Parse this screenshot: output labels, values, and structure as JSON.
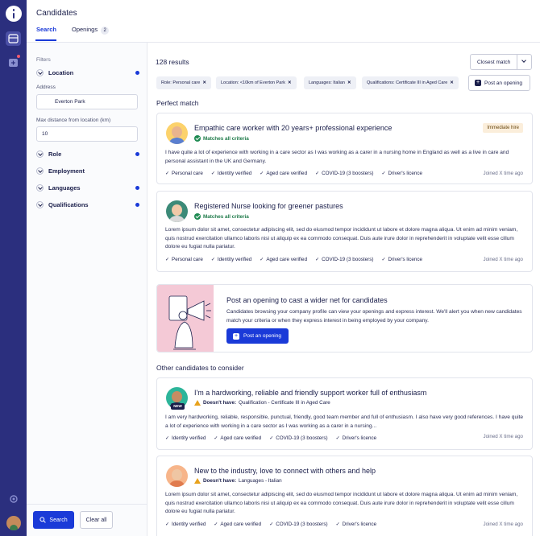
{
  "header": {
    "title": "Candidates",
    "tabs": [
      {
        "label": "Search"
      },
      {
        "label": "Openings",
        "count": "2"
      }
    ]
  },
  "filters": {
    "title": "Filters",
    "location": {
      "label": "Location",
      "address_label": "Address",
      "address_value": "Everton Park",
      "distance_label": "Max distance from location (km)",
      "distance_value": "10"
    },
    "groups": [
      {
        "label": "Role",
        "active": true
      },
      {
        "label": "Employment",
        "active": false
      },
      {
        "label": "Languages",
        "active": true
      },
      {
        "label": "Qualifications",
        "active": true
      }
    ],
    "search_button": "Search",
    "clear_button": "Clear all"
  },
  "results": {
    "count": "128 results",
    "sort_label": "Closest match",
    "chips": [
      "Role: Personal care",
      "Location: <10km of Everton Park",
      "Languages: Italian",
      "Qualifications: Certificate III in Aged Care"
    ],
    "post_opening": "Post an opening"
  },
  "perfect_match": {
    "title": "Perfect match",
    "cards": [
      {
        "title": "Empathic care worker with 20 years+ professional experience",
        "match": "Matches all criteria",
        "badge": "Immediate hire",
        "body": "I have quite a lot of experience with working in a care sector as I was working as a carer in a nursing home in England as well as a live in care and personal assistant in the UK and Germany.",
        "tags": [
          "Personal care",
          "Identity verified",
          "Aged care verified",
          "COVID-19 (3 boosters)",
          "Driver's licence"
        ],
        "joined": "Joined X time ago"
      },
      {
        "title": "Registered Nurse looking for greener pastures",
        "match": "Matches all criteria",
        "body": "Lorem ipsum dolor sit amet, consectetur adipiscing elit, sed do eiusmod tempor incididunt ut labore et dolore magna aliqua. Ut enim ad minim veniam, quis nostrud exercitation ullamco laboris nisi ut aliquip ex ea commodo consequat. Duis aute irure dolor in reprehenderit in voluptate velit esse cillum dolore eu fugiat nulla pariatur.",
        "tags": [
          "Personal care",
          "Identity verified",
          "Aged care verified",
          "COVID-19 (3 boosters)",
          "Driver's licence"
        ],
        "joined": "Joined X time ago"
      }
    ]
  },
  "promo": {
    "title": "Post an opening to cast a wider net for candidates",
    "text": "Candidates browsing your company profile can view your openings and express interest. We'll alert you when new candidates match your criteria or when they express interest in being employed by your company.",
    "button": "Post an opening"
  },
  "other": {
    "title": "Other candidates to consider",
    "cards": [
      {
        "title": "I'm a hardworking, reliable and friendly support worker full of enthusiasm",
        "doesnt_have_label": "Doesn't have:",
        "doesnt_have": "Qualification - Certificate III in Aged Care",
        "new_badge": "NEW",
        "body": "I am very hardworking, reliable, responsible, punctual, friendly, good team member and full of enthusiasm. I also have very good references. I have quite a lot of experience with working in a care sector as I was working as a carer in a nursing...",
        "tags": [
          "Identity verified",
          "Aged care verified",
          "COVID-19 (3 boosters)",
          "Driver's licence"
        ],
        "joined": "Joined X time ago"
      },
      {
        "title": "New to the industry, love to connect with others and help",
        "doesnt_have_label": "Doesn't have:",
        "doesnt_have": "Languages - Italian",
        "body": "Lorem ipsum dolor sit amet, consectetur adipiscing elit, sed do eiusmod tempor incididunt ut labore et dolore magna aliqua. Ut enim ad minim veniam, quis nostrud exercitation ullamco laboris nisi ut aliquip ex ea commodo consequat. Duis aute irure dolor in reprehenderit in voluptate velit esse cillum dolore eu fugiat nulla pariatur.",
        "tags": [
          "Identity verified",
          "Aged care verified",
          "COVID-19 (3 boosters)",
          "Driver's licence"
        ],
        "joined": "Joined X time ago"
      }
    ]
  },
  "colors": {
    "rail": "#2b2f7e",
    "accent": "#1a3ad8",
    "match_green": "#1e8a52",
    "warning": "#e8a21c"
  }
}
